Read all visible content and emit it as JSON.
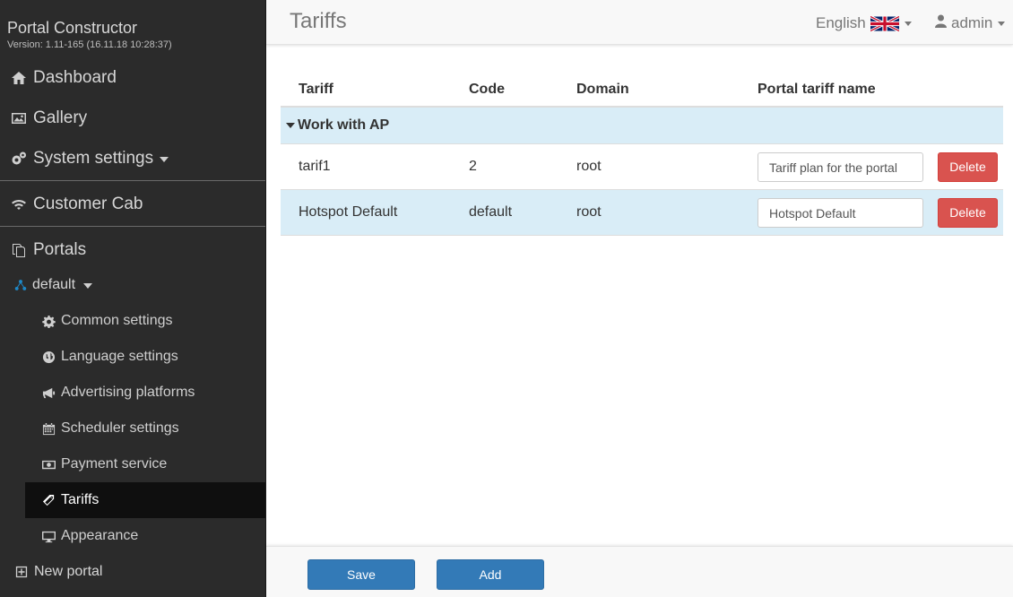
{
  "app": {
    "title": "Portal Constructor",
    "version": "Version: 1.11-165 (16.11.18 10:28:37)"
  },
  "sidebar": {
    "top_items": [
      {
        "label": "Dashboard",
        "icon": "home-icon"
      },
      {
        "label": "Gallery",
        "icon": "image-icon"
      },
      {
        "label": "System settings",
        "icon": "gears-icon"
      },
      {
        "label": "Customer Cab",
        "icon": "wifi-icon"
      },
      {
        "label": "Portals",
        "icon": "copy-icon"
      }
    ],
    "portal": {
      "label": "default",
      "icon": "sitemap-icon"
    },
    "sub_items": [
      {
        "label": "Common settings",
        "icon": "gear-icon"
      },
      {
        "label": "Language settings",
        "icon": "globe-icon"
      },
      {
        "label": "Advertising platforms",
        "icon": "bullhorn-icon"
      },
      {
        "label": "Scheduler settings",
        "icon": "calendar-icon"
      },
      {
        "label": "Payment service",
        "icon": "money-icon"
      },
      {
        "label": "Tariffs",
        "icon": "tags-icon",
        "active": true
      },
      {
        "label": "Appearance",
        "icon": "desktop-icon"
      }
    ],
    "new_portal": {
      "label": "New portal",
      "icon": "plus-square-icon"
    }
  },
  "header": {
    "title": "Tariffs",
    "language": "English",
    "user": "admin"
  },
  "table": {
    "columns": [
      "Tariff",
      "Code",
      "Domain",
      "Portal tariff name"
    ],
    "group": "Work with AP",
    "rows": [
      {
        "tariff": "tarif1",
        "code": "2",
        "domain": "root",
        "portal_name": "Tariff plan for the portal",
        "delete_label": "Delete"
      },
      {
        "tariff": "Hotspot Default",
        "code": "default",
        "domain": "root",
        "portal_name": "Hotspot Default",
        "delete_label": "Delete"
      }
    ]
  },
  "footer": {
    "save_label": "Save",
    "add_label": "Add"
  },
  "colors": {
    "sidebar_bg": "#2b2b2b",
    "active_bg": "#0f0f0f",
    "row_highlight": "#d9edf7",
    "primary": "#337ab7",
    "danger": "#d9534f"
  }
}
